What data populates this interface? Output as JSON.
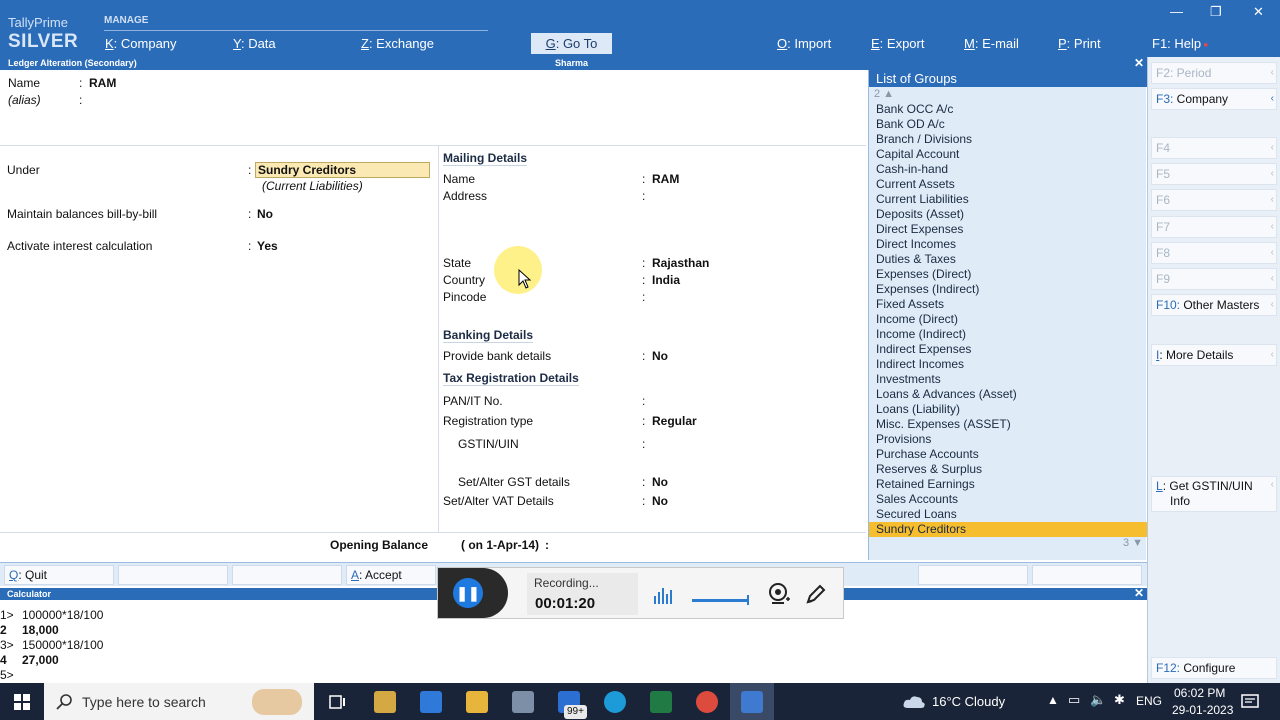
{
  "app": {
    "brand_line1": "TallyPrime",
    "brand_line2": "SILVER",
    "manage_label": "MANAGE"
  },
  "top_menu": [
    {
      "key": "K",
      "label": ": Company"
    },
    {
      "key": "Y",
      "label": ": Data"
    },
    {
      "key": "Z",
      "label": ": Exchange"
    },
    {
      "key": "G",
      "label": ": Go To"
    },
    {
      "key": "O",
      "label": ": Import"
    },
    {
      "key": "E",
      "label": ": Export"
    },
    {
      "key": "M",
      "label": ": E-mail"
    },
    {
      "key": "P",
      "label": ": Print"
    },
    {
      "key": "F1",
      "label": ": Help"
    }
  ],
  "window_controls": {
    "minimize": "—",
    "restore": "❐",
    "close": "✕"
  },
  "screen": {
    "title": "Ledger Alteration (Secondary)",
    "company": "Sharma",
    "close": "✕"
  },
  "form": {
    "name_label": "Name",
    "name_value": "RAM",
    "alias_label": "(alias)",
    "under_label": "Under",
    "under_value": "Sundry Creditors",
    "under_parent": "(Current Liabilities)",
    "bill_label": "Maintain balances bill-by-bill",
    "bill_value": "No",
    "interest_label": "Activate interest calculation",
    "interest_value": "Yes",
    "colon": ":"
  },
  "mailing": {
    "title": "Mailing Details",
    "name_label": "Name",
    "name_value": "RAM",
    "address_label": "Address",
    "state_label": "State",
    "state_value": "Rajasthan",
    "country_label": "Country",
    "country_value": "India",
    "pincode_label": "Pincode"
  },
  "banking": {
    "title": "Banking Details",
    "provide_label": "Provide bank details",
    "provide_value": "No"
  },
  "tax": {
    "title": "Tax Registration Details",
    "pan_label": "PAN/IT No.",
    "regtype_label": "Registration type",
    "regtype_value": "Regular",
    "gstin_label": "GSTIN/UIN",
    "gst_label": "Set/Alter GST details",
    "gst_value": "No",
    "vat_label": "Set/Alter VAT Details",
    "vat_value": "No"
  },
  "opening_balance": {
    "label": "Opening Balance",
    "date": "( on 1-Apr-14)",
    "colon": ":"
  },
  "groups": {
    "title": "List of Groups",
    "page_top": "2 ▲",
    "page_bottom": "3 ▼",
    "selected": "Sundry Creditors",
    "items": [
      "Bank OCC A/c",
      "Bank OD A/c",
      "Branch / Divisions",
      "Capital Account",
      "Cash-in-hand",
      "Current Assets",
      "Current Liabilities",
      "Deposits (Asset)",
      "Direct Expenses",
      "Direct Incomes",
      "Duties & Taxes",
      "Expenses (Direct)",
      "Expenses (Indirect)",
      "Fixed Assets",
      "Income (Direct)",
      "Income (Indirect)",
      "Indirect Expenses",
      "Indirect Incomes",
      "Investments",
      "Loans & Advances (Asset)",
      "Loans (Liability)",
      "Misc. Expenses (ASSET)",
      "Provisions",
      "Purchase Accounts",
      "Reserves & Surplus",
      "Retained Earnings",
      "Sales Accounts",
      "Secured Loans",
      "Sundry Creditors"
    ]
  },
  "right_panel": {
    "f2": {
      "key": "F2:",
      "label": " Period"
    },
    "f3": {
      "key": "F3:",
      "label": " Company"
    },
    "f4": "F4",
    "f5": "F5",
    "f6": "F6",
    "f7": "F7",
    "f8": "F8",
    "f9": "F9",
    "f10": {
      "key": "F10:",
      "label": " Other Masters"
    },
    "more": {
      "key": "I",
      "label": ": More Details"
    },
    "gstin": {
      "key": "L",
      "label": ": Get GSTIN/UIN",
      "label2": "Info"
    },
    "f12": {
      "key": "F12:",
      "label": " Configure"
    }
  },
  "footer": {
    "quit_key": "Q",
    "quit_label": ": Quit",
    "accept_key": "A",
    "accept_label": ": Accept"
  },
  "calculator": {
    "title": "Calculator",
    "close": "✕",
    "lines": [
      {
        "prefix": "1>",
        "text": "100000*18/100",
        "bold": false
      },
      {
        "prefix": "2",
        "text": "18,000",
        "bold": true
      },
      {
        "prefix": "3>",
        "text": "150000*18/100",
        "bold": false
      },
      {
        "prefix": "4",
        "text": "27,000",
        "bold": true
      },
      {
        "prefix": "5>",
        "text": "",
        "bold": false
      }
    ]
  },
  "recording": {
    "status": "Recording...",
    "time": "00:01:20"
  },
  "taskbar": {
    "search_placeholder": "Type here to search",
    "mail_badge": "99+",
    "weather": "16°C  Cloudy",
    "lang": "ENG",
    "time": "06:02 PM",
    "date": "29-01-2023"
  },
  "colors": {
    "accent": "#2b6cb8",
    "selected": "#f6bd2e",
    "list_bg": "#dfecf8"
  }
}
